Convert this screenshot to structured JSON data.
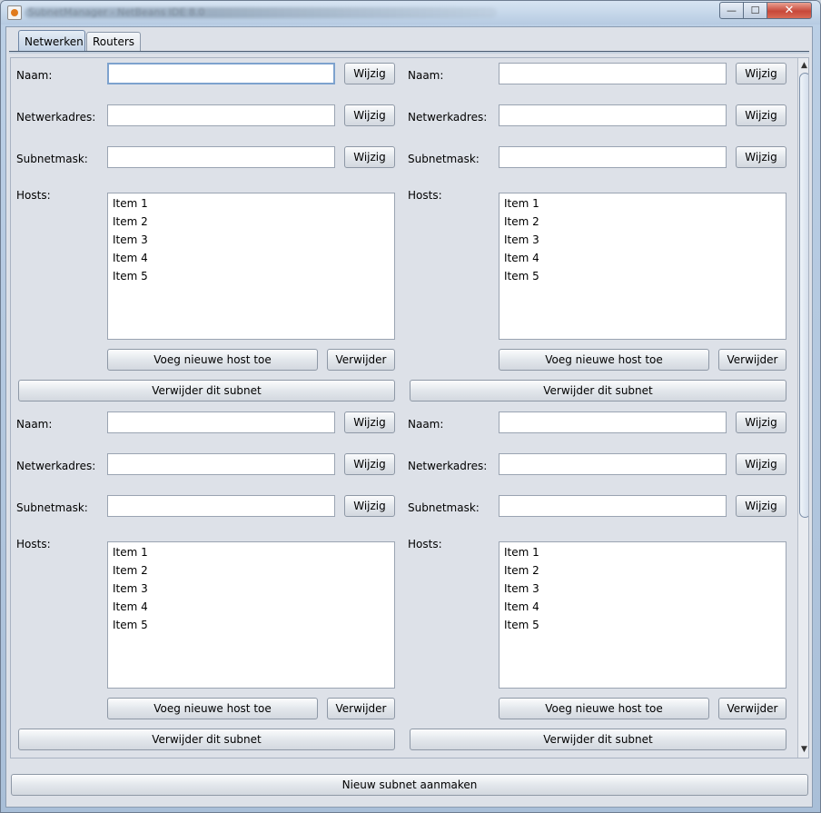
{
  "window": {
    "title": "SubnetManager - NetBeans IDE 8.0",
    "controls": {
      "minimize": "—",
      "maximize": "☐",
      "close": "✕"
    }
  },
  "tabs": [
    {
      "label": "Netwerken",
      "selected": true
    },
    {
      "label": "Routers",
      "selected": false
    }
  ],
  "subnets": [
    {
      "naam_label": "Naam:",
      "naam_value": "",
      "naam_button": "Wijzig",
      "netwerkadres_label": "Netwerkadres:",
      "netwerkadres_value": "",
      "netwerkadres_button": "Wijzig",
      "subnetmask_label": "Subnetmask:",
      "subnetmask_value": "",
      "subnetmask_button": "Wijzig",
      "hosts_label": "Hosts:",
      "hosts": [
        "Item 1",
        "Item 2",
        "Item 3",
        "Item 4",
        "Item 5"
      ],
      "add_host_button": "Voeg nieuwe host toe",
      "remove_host_button": "Verwijder",
      "remove_subnet_button": "Verwijder dit subnet"
    },
    {
      "naam_label": "Naam:",
      "naam_value": "",
      "naam_button": "Wijzig",
      "netwerkadres_label": "Netwerkadres:",
      "netwerkadres_value": "",
      "netwerkadres_button": "Wijzig",
      "subnetmask_label": "Subnetmask:",
      "subnetmask_value": "",
      "subnetmask_button": "Wijzig",
      "hosts_label": "Hosts:",
      "hosts": [
        "Item 1",
        "Item 2",
        "Item 3",
        "Item 4",
        "Item 5"
      ],
      "add_host_button": "Voeg nieuwe host toe",
      "remove_host_button": "Verwijder",
      "remove_subnet_button": "Verwijder dit subnet"
    },
    {
      "naam_label": "Naam:",
      "naam_value": "",
      "naam_button": "Wijzig",
      "netwerkadres_label": "Netwerkadres:",
      "netwerkadres_value": "",
      "netwerkadres_button": "Wijzig",
      "subnetmask_label": "Subnetmask:",
      "subnetmask_value": "",
      "subnetmask_button": "Wijzig",
      "hosts_label": "Hosts:",
      "hosts": [
        "Item 1",
        "Item 2",
        "Item 3",
        "Item 4",
        "Item 5"
      ],
      "add_host_button": "Voeg nieuwe host toe",
      "remove_host_button": "Verwijder",
      "remove_subnet_button": "Verwijder dit subnet"
    },
    {
      "naam_label": "Naam:",
      "naam_value": "",
      "naam_button": "Wijzig",
      "netwerkadres_label": "Netwerkadres:",
      "netwerkadres_value": "",
      "netwerkadres_button": "Wijzig",
      "subnetmask_label": "Subnetmask:",
      "subnetmask_value": "",
      "subnetmask_button": "Wijzig",
      "hosts_label": "Hosts:",
      "hosts": [
        "Item 1",
        "Item 2",
        "Item 3",
        "Item 4",
        "Item 5"
      ],
      "add_host_button": "Voeg nieuwe host toe",
      "remove_host_button": "Verwijder",
      "remove_subnet_button": "Verwijder dit subnet"
    }
  ],
  "scrollbar": {
    "up_arrow": "▲",
    "down_arrow": "▼"
  },
  "footer": {
    "new_subnet_button": "Nieuw subnet aanmaken"
  },
  "colors": {
    "window_frame": "#a9bfd8",
    "client_bg": "#dde1e8",
    "close_button": "#c7483a",
    "focus_border": "#7da2ce"
  }
}
